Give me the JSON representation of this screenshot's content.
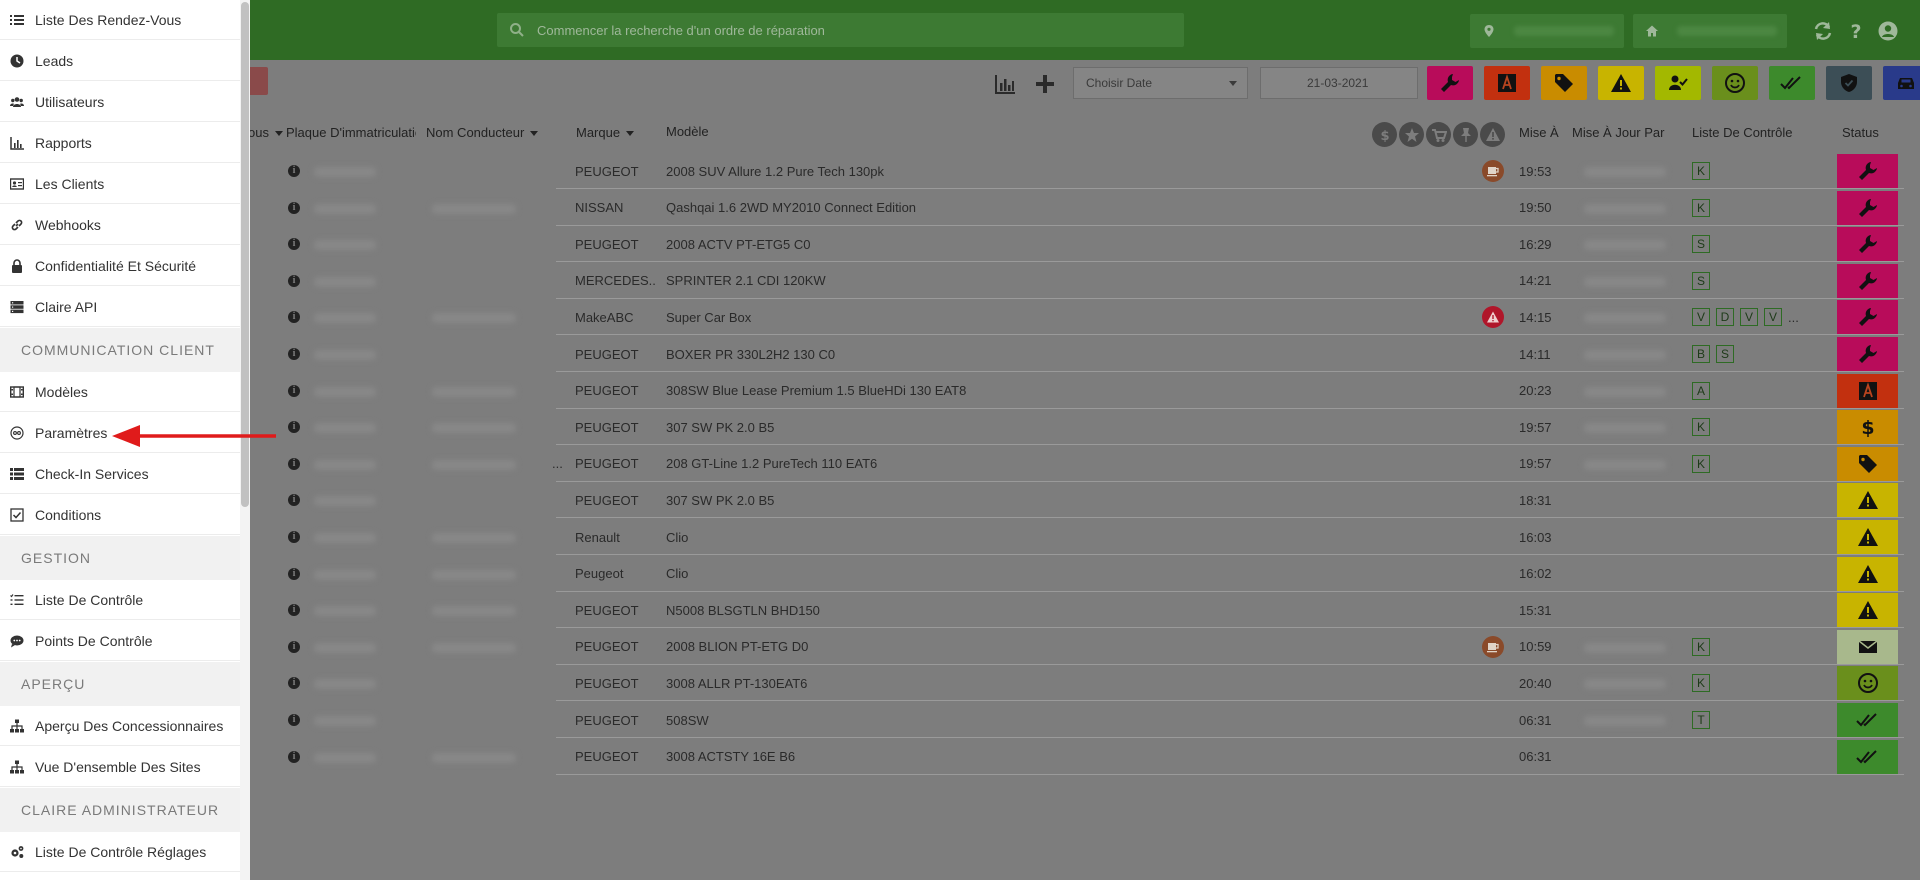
{
  "header": {
    "search_placeholder": "Commencer la recherche d'un ordre de réparation"
  },
  "toolbar": {
    "date_placeholder": "Choisir Date",
    "date_value": "21-03-2021",
    "status_buttons": [
      {
        "icon": "wrench-icon",
        "color": "#b80c5a"
      },
      {
        "icon": "a-square-icon",
        "color": "#c2300f"
      },
      {
        "icon": "tag-icon",
        "color": "#c98c00"
      },
      {
        "icon": "warning-icon",
        "color": "#c8b400"
      },
      {
        "icon": "user-check-icon",
        "color": "#a3b800"
      },
      {
        "icon": "smiley-icon",
        "color": "#6a8f1c"
      },
      {
        "icon": "double-check-icon",
        "color": "#3d8a2c"
      },
      {
        "icon": "shield-icon",
        "color": "#3c4e56"
      },
      {
        "icon": "car-icon",
        "color": "#293a8a"
      }
    ]
  },
  "table": {
    "headers": {
      "col0": "ous",
      "plate": "Plaque D'immatriculatic",
      "driver": "Nom Conducteur",
      "brand": "Marque",
      "model": "Modèle",
      "updated": "Mise À",
      "updated_by": "Mise À Jour Par",
      "checklist": "Liste De Contrôle",
      "status": "Status"
    },
    "rows": [
      {
        "brand": "PEUGEOT",
        "model": "2008 SUV Allure 1.2 Pure Tech 130pk",
        "time": "19:53",
        "badge": "coffee",
        "checks": [
          "K"
        ],
        "status": "wrench-icon",
        "status_color": "#b80c5a"
      },
      {
        "brand": "NISSAN",
        "model": "Qashqai 1.6 2WD MY2010 Connect Edition",
        "time": "19:50",
        "badge": "",
        "checks": [
          "K"
        ],
        "status": "wrench-icon",
        "status_color": "#b80c5a"
      },
      {
        "brand": "PEUGEOT",
        "model": "2008 ACTV PT-ETG5 C0",
        "time": "16:29",
        "badge": "",
        "checks": [
          "S"
        ],
        "status": "wrench-icon",
        "status_color": "#b80c5a"
      },
      {
        "brand": "MERCEDES...",
        "model": "SPRINTER 2.1 CDI 120KW",
        "time": "14:21",
        "badge": "",
        "checks": [
          "S"
        ],
        "status": "wrench-icon",
        "status_color": "#b80c5a"
      },
      {
        "brand": "MakeABC",
        "model": "Super Car Box",
        "time": "14:15",
        "badge": "warning",
        "checks": [
          "V",
          "D",
          "V",
          "V"
        ],
        "more": "...",
        "status": "wrench-icon",
        "status_color": "#b80c5a"
      },
      {
        "brand": "PEUGEOT",
        "model": "BOXER PR 330L2H2 130 C0",
        "time": "14:11",
        "badge": "",
        "checks": [
          "B",
          "S"
        ],
        "status": "wrench-icon",
        "status_color": "#b80c5a"
      },
      {
        "brand": "PEUGEOT",
        "model": "308SW Blue Lease Premium 1.5 BlueHDi 130 EAT8",
        "time": "20:23",
        "badge": "",
        "checks": [
          "A"
        ],
        "status": "a-square-icon",
        "status_color": "#c2300f"
      },
      {
        "brand": "PEUGEOT",
        "model": "307 SW PK 2.0 B5",
        "time": "19:57",
        "badge": "",
        "checks": [
          "K"
        ],
        "status": "dollar-icon",
        "status_color": "#c98c00"
      },
      {
        "brand": "PEUGEOT",
        "model": "208 GT-Line 1.2 PureTech 110 EAT6",
        "time": "19:57",
        "badge": "",
        "checks": [
          "K"
        ],
        "driver_trunc": "...",
        "status": "tag-icon",
        "status_color": "#c98c00"
      },
      {
        "brand": "PEUGEOT",
        "model": "307 SW PK 2.0 B5",
        "time": "18:31",
        "badge": "",
        "checks": [],
        "status": "warning-icon",
        "status_color": "#c8b400"
      },
      {
        "brand": "Renault",
        "model": "Clio",
        "time": "16:03",
        "badge": "",
        "checks": [],
        "status": "warning-icon",
        "status_color": "#c8b400"
      },
      {
        "brand": "Peugeot",
        "model": "Clio",
        "time": "16:02",
        "badge": "",
        "checks": [],
        "status": "warning-icon",
        "status_color": "#c8b400"
      },
      {
        "brand": "PEUGEOT",
        "model": "N5008 BLSGTLN BHD150",
        "time": "15:31",
        "badge": "",
        "checks": [],
        "status": "warning-icon",
        "status_color": "#c8b400"
      },
      {
        "brand": "PEUGEOT",
        "model": "2008 BLION PT-ETG D0",
        "time": "10:59",
        "badge": "coffee",
        "checks": [
          "K"
        ],
        "status": "envelope-icon",
        "status_color": "#a8b88c"
      },
      {
        "brand": "PEUGEOT",
        "model": "3008 ALLR PT-130EAT6",
        "time": "20:40",
        "badge": "",
        "checks": [
          "K"
        ],
        "status": "smiley-icon",
        "status_color": "#6a8f1c"
      },
      {
        "brand": "PEUGEOT",
        "model": "508SW",
        "time": "06:31",
        "badge": "",
        "checks": [
          "T"
        ],
        "status": "double-check-icon",
        "status_color": "#3d8a2c"
      },
      {
        "brand": "PEUGEOT",
        "model": "3008 ACTSTY 16E B6",
        "time": "06:31",
        "badge": "",
        "checks": [],
        "status": "double-check-icon",
        "status_color": "#3d8a2c"
      }
    ]
  },
  "sidebar": {
    "items": [
      {
        "type": "item",
        "label": "Liste Des Rendez-Vous",
        "icon": "list-icon"
      },
      {
        "type": "item",
        "label": "Leads",
        "icon": "clock-icon"
      },
      {
        "type": "item",
        "label": "Utilisateurs",
        "icon": "users-icon"
      },
      {
        "type": "item",
        "label": "Rapports",
        "icon": "chart-icon"
      },
      {
        "type": "item",
        "label": "Les Clients",
        "icon": "id-card-icon"
      },
      {
        "type": "item",
        "label": "Webhooks",
        "icon": "link-icon"
      },
      {
        "type": "item",
        "label": "Confidentialité Et Sécurité",
        "icon": "lock-icon"
      },
      {
        "type": "item",
        "label": "Claire API",
        "icon": "server-icon"
      },
      {
        "type": "header",
        "label": "COMMUNICATION CLIENT"
      },
      {
        "type": "item",
        "label": "Modèles",
        "icon": "film-icon"
      },
      {
        "type": "item",
        "label": "Paramètres",
        "icon": "settings-circle-icon"
      },
      {
        "type": "item",
        "label": "Check-In Services",
        "icon": "list-grid-icon"
      },
      {
        "type": "item",
        "label": "Conditions",
        "icon": "checkbox-icon"
      },
      {
        "type": "header",
        "label": "GESTION"
      },
      {
        "type": "item",
        "label": "Liste De Contrôle",
        "icon": "tasks-icon"
      },
      {
        "type": "item",
        "label": "Points De Contrôle",
        "icon": "comment-icon"
      },
      {
        "type": "header",
        "label": "APERÇU"
      },
      {
        "type": "item",
        "label": "Aperçu Des Concessionnaires",
        "icon": "sitemap-icon"
      },
      {
        "type": "item",
        "label": "Vue D'ensemble Des Sites",
        "icon": "sitemap-icon"
      },
      {
        "type": "header",
        "label": "CLAIRE ADMINISTRATEUR"
      },
      {
        "type": "item",
        "label": "Liste De Contrôle Réglages",
        "icon": "cogs-icon"
      }
    ]
  }
}
